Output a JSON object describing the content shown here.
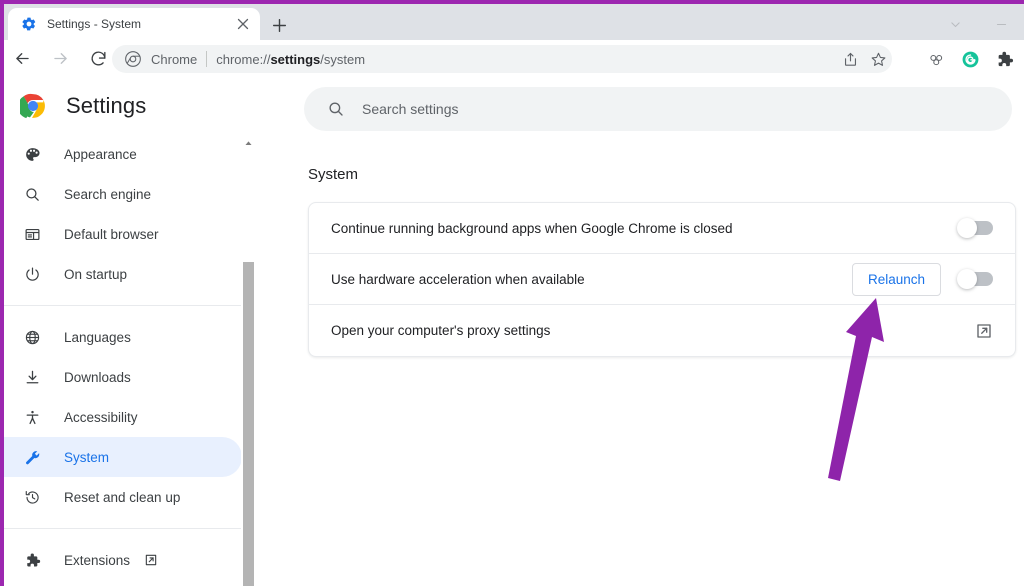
{
  "window": {
    "controls": [
      {
        "name": "chevron-down",
        "icon": "chevron-down-icon"
      },
      {
        "name": "minimize",
        "icon": "minimize-icon"
      }
    ]
  },
  "tabstrip": {
    "tabs": [
      {
        "title": "Settings - System",
        "favicon": "gear-icon",
        "close_label": "×",
        "active": true
      }
    ],
    "new_tab_label": "+"
  },
  "toolbar": {
    "back_icon": "back-arrow-icon",
    "forward_icon": "forward-arrow-icon",
    "reload_icon": "reload-icon",
    "omnibox": {
      "page_icon": "chrome-icon",
      "chip_text": "Chrome",
      "url_prefix": "chrome://",
      "url_bold": "settings",
      "url_suffix": "/system"
    },
    "actions": [
      {
        "name": "share-icon"
      },
      {
        "name": "bookmark-star-icon"
      }
    ],
    "right_icons": [
      {
        "name": "contacts-icon"
      },
      {
        "name": "grammarly-icon",
        "color": "#15c39a",
        "letter": "G"
      },
      {
        "name": "extensions-puzzle-icon"
      }
    ]
  },
  "sidebar": {
    "brand": "Settings",
    "brand_logo": "chrome-logo",
    "groups": [
      {
        "items": [
          {
            "label": "Appearance",
            "icon": "palette-icon",
            "active": false
          },
          {
            "label": "Search engine",
            "icon": "search-icon",
            "active": false
          },
          {
            "label": "Default browser",
            "icon": "browser-window-icon",
            "active": false
          },
          {
            "label": "On startup",
            "icon": "power-icon",
            "active": false
          }
        ]
      },
      {
        "items": [
          {
            "label": "Languages",
            "icon": "globe-icon",
            "active": false
          },
          {
            "label": "Downloads",
            "icon": "download-icon",
            "active": false
          },
          {
            "label": "Accessibility",
            "icon": "accessibility-icon",
            "active": false
          },
          {
            "label": "System",
            "icon": "wrench-icon",
            "active": true
          },
          {
            "label": "Reset and clean up",
            "icon": "history-restore-icon",
            "active": false
          }
        ]
      },
      {
        "items": [
          {
            "label": "Extensions",
            "icon": "puzzle-icon",
            "active": false,
            "external": true
          }
        ]
      }
    ],
    "scrollbar": {
      "up_arrow": "scroll-up-arrow-icon"
    }
  },
  "main": {
    "search": {
      "placeholder": "Search settings",
      "value": "",
      "icon": "search-icon"
    },
    "section_title": "System",
    "rows": [
      {
        "label": "Continue running background apps when Google Chrome is closed",
        "control": "toggle",
        "toggle_on": false
      },
      {
        "label": "Use hardware acceleration when available",
        "control": "toggle-with-button",
        "button_label": "Relaunch",
        "toggle_on": false
      },
      {
        "label": "Open your computer's proxy settings",
        "control": "external-link",
        "icon": "external-link-icon"
      }
    ]
  },
  "annotation": {
    "arrow_color": "#8e24aa",
    "frame_color": "#9c27b0"
  },
  "colors": {
    "accent": "#1a73e8",
    "active_bg": "#e8f0fe",
    "tabstrip_bg": "#dee1e6",
    "omnibox_bg": "#f1f3f4",
    "divider": "#e8eaed"
  }
}
